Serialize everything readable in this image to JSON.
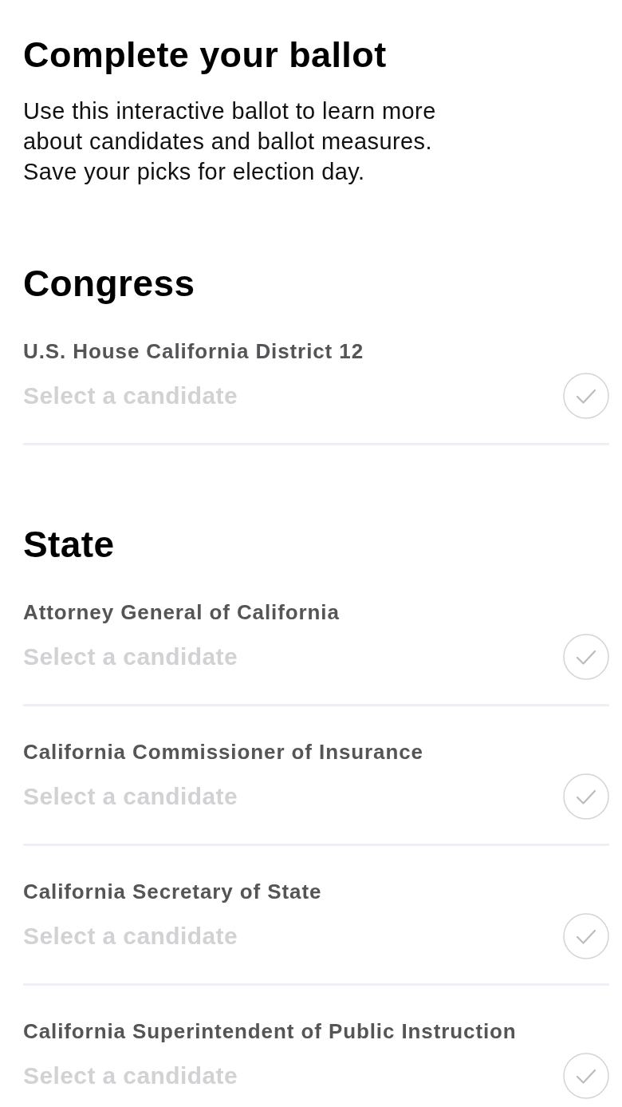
{
  "title": "Complete your ballot",
  "intro": "Use this interactive ballot to learn more about candidates and ballot measures. Save your picks for election day.",
  "sections": [
    {
      "heading": "Congress",
      "races": [
        {
          "office": "U.S. House California District 12",
          "prompt": "Select a candidate",
          "completed": false
        }
      ]
    },
    {
      "heading": "State",
      "races": [
        {
          "office": "Attorney General of California",
          "prompt": "Select a candidate",
          "completed": false
        },
        {
          "office": "California Commissioner of Insurance",
          "prompt": "Select a candidate",
          "completed": false
        },
        {
          "office": "California Secretary of State",
          "prompt": "Select a candidate",
          "completed": false
        },
        {
          "office": "California Superintendent of Public Instruction",
          "prompt": "Select a candidate",
          "completed": false
        }
      ]
    }
  ]
}
